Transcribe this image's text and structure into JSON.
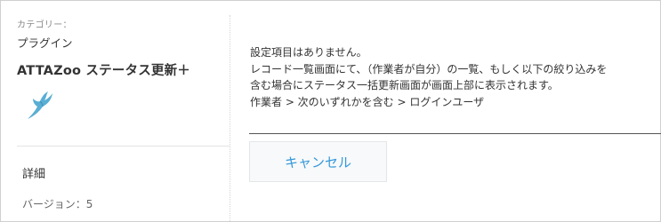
{
  "sidebar": {
    "category_label": "カテゴリー：",
    "category_value": "プラグイン",
    "plugin_name": "ATTAZoo ステータス更新＋",
    "plugin_icon": "bird-icon",
    "details_label": "詳細",
    "version_label": "バージョン：",
    "version_value": "5"
  },
  "main": {
    "lines": [
      "設定項目はありません。",
      "レコード一覧画面にて、（作業者が自分）の一覧、もしく以下の絞り込みを",
      "含む場合にステータス一括更新画面が画面上部に表示されます。",
      "作業者 > 次のいずれかを含む > ログインユーザ"
    ],
    "cancel_label": "キャンセル"
  },
  "colors": {
    "accent": "#3498db",
    "icon": "#5aaed4"
  }
}
